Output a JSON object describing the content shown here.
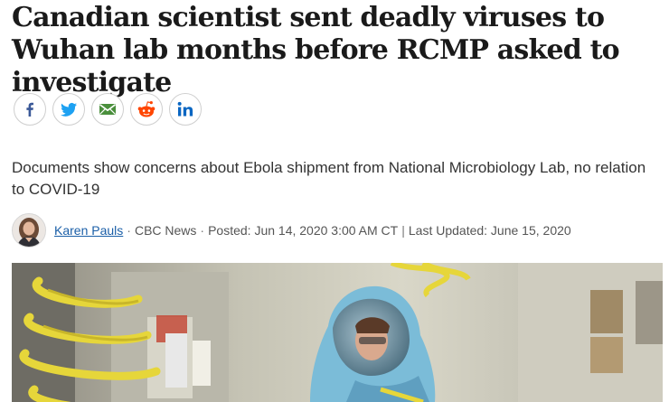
{
  "article": {
    "headline": "Canadian scientist sent deadly viruses to Wuhan lab months before RCMP asked to investigate",
    "deck": "Documents show concerns about Ebola shipment from National Microbiology Lab, no relation to COVID-19"
  },
  "share": {
    "buttons": [
      {
        "icon": "facebook-icon",
        "color": "#3b5998"
      },
      {
        "icon": "twitter-icon",
        "color": "#1da1f2"
      },
      {
        "icon": "email-icon",
        "color": "#4a8f3c"
      },
      {
        "icon": "reddit-icon",
        "color": "#ff4500"
      },
      {
        "icon": "linkedin-icon",
        "color": "#0a66c2"
      }
    ]
  },
  "byline": {
    "author": "Karen Pauls",
    "outlet": "CBC News",
    "posted": "Posted: Jun 14, 2020 3:00 AM CT",
    "divider": "|",
    "updated": "Last Updated: June 15, 2020",
    "dot": "·"
  },
  "colors": {
    "link": "#1b5fa8",
    "hose": "#e6d63a",
    "suit": "#7bbcd8"
  }
}
